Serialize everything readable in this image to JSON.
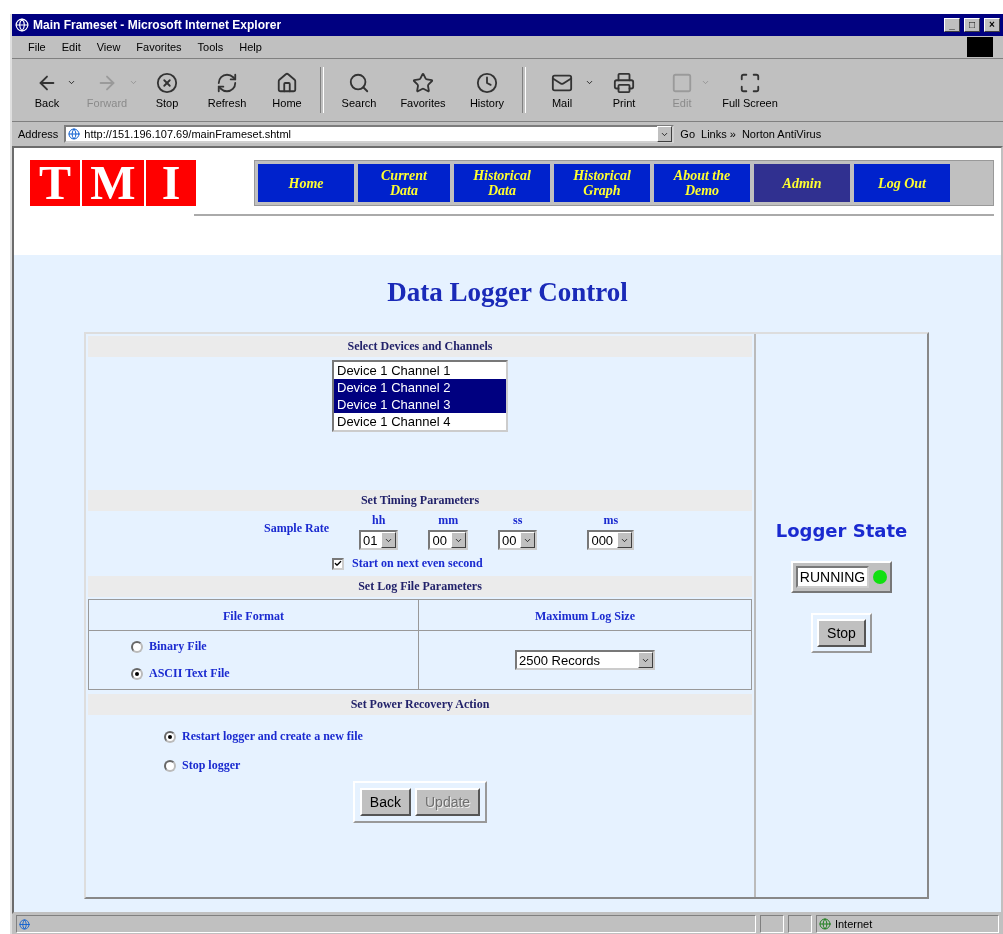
{
  "window": {
    "title": "Main Frameset - Microsoft Internet Explorer",
    "controls": [
      "_",
      "□",
      "×"
    ]
  },
  "menu": [
    "File",
    "Edit",
    "View",
    "Favorites",
    "Tools",
    "Help"
  ],
  "toolbar": [
    {
      "label": "Back",
      "kind": "back",
      "disabled": false,
      "has_menu": true
    },
    {
      "label": "Forward",
      "kind": "forward",
      "disabled": true,
      "has_menu": true
    },
    {
      "label": "Stop",
      "kind": "stop",
      "disabled": false,
      "has_menu": false
    },
    {
      "label": "Refresh",
      "kind": "refresh",
      "disabled": false,
      "has_menu": false
    },
    {
      "label": "Home",
      "kind": "home",
      "disabled": false,
      "has_menu": false
    },
    {
      "label": "Search",
      "kind": "search",
      "disabled": false,
      "has_menu": false
    },
    {
      "label": "Favorites",
      "kind": "favorites",
      "disabled": false,
      "has_menu": false
    },
    {
      "label": "History",
      "kind": "history",
      "disabled": false,
      "has_menu": false
    },
    {
      "label": "Mail",
      "kind": "mail",
      "disabled": false,
      "has_menu": true
    },
    {
      "label": "Print",
      "kind": "print",
      "disabled": false,
      "has_menu": false
    },
    {
      "label": "Edit",
      "kind": "edit",
      "disabled": true,
      "has_menu": true
    },
    {
      "label": "Full Screen",
      "kind": "fullscreen",
      "disabled": false,
      "has_menu": false
    }
  ],
  "address": {
    "label": "Address",
    "value": "http://151.196.107.69/mainFrameset.shtml",
    "go": "Go",
    "links": "Links »",
    "link": "Norton AntiVirus"
  },
  "logo": {
    "letters": [
      "T",
      "M",
      "I"
    ]
  },
  "nav": [
    {
      "label": "Home",
      "selected": false
    },
    {
      "label": "Current Data",
      "selected": false
    },
    {
      "label": "Historical Data",
      "selected": false
    },
    {
      "label": "Historical Graph",
      "selected": false
    },
    {
      "label": "About the Demo",
      "selected": false
    },
    {
      "label": "Admin",
      "selected": true
    },
    {
      "label": "Log Out",
      "selected": false
    }
  ],
  "heading": "Data Logger Control",
  "devices": {
    "title": "Select Devices and Channels",
    "items": [
      {
        "label": "Device 1 Channel 1",
        "selected": false
      },
      {
        "label": "Device 1 Channel 2",
        "selected": true
      },
      {
        "label": "Device 1 Channel 3",
        "selected": true
      },
      {
        "label": "Device 1 Channel 4",
        "selected": false
      }
    ]
  },
  "timing": {
    "title": "Set Timing Parameters",
    "label": "Sample Rate",
    "fields": [
      {
        "unit": "hh",
        "value": "01"
      },
      {
        "unit": "mm",
        "value": "00"
      },
      {
        "unit": "ss",
        "value": "00"
      },
      {
        "unit": "ms",
        "value": "000"
      }
    ],
    "checkbox": {
      "label": "Start on next even second",
      "checked": true
    }
  },
  "log_file": {
    "title": "Set Log File Parameters",
    "format_header": "File Format",
    "formats": [
      {
        "label": "Binary File",
        "selected": false
      },
      {
        "label": "ASCII Text File",
        "selected": true
      }
    ],
    "size_header": "Maximum Log Size",
    "size_value": "2500 Records"
  },
  "power": {
    "title": "Set Power Recovery Action",
    "options": [
      {
        "label": "Restart logger and create a new file",
        "selected": true
      },
      {
        "label": "Stop logger",
        "selected": false
      }
    ]
  },
  "buttons": [
    {
      "label": "Back",
      "disabled": false
    },
    {
      "label": "Update",
      "disabled": true
    }
  ],
  "logger": {
    "title": "Logger State",
    "status": "RUNNING",
    "color": "#10e010",
    "button": "Stop"
  },
  "status_bar": {
    "zone": "Internet"
  }
}
